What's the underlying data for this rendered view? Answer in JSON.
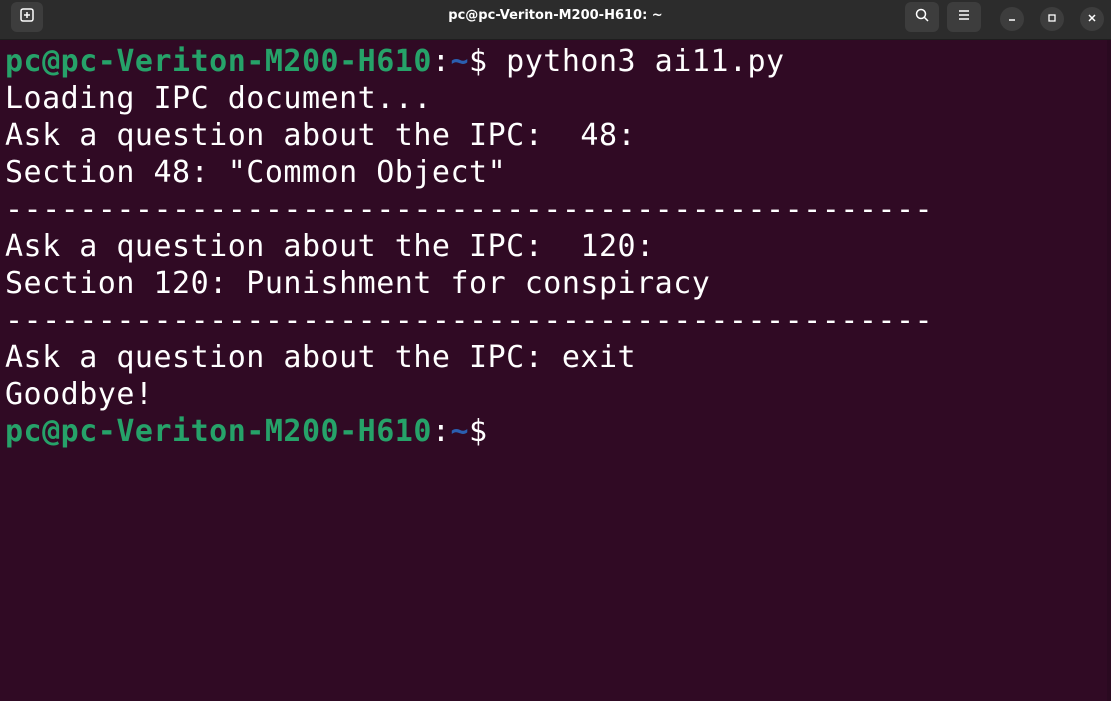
{
  "window": {
    "title": "pc@pc-Veriton-M200-H610: ~"
  },
  "titlebar_icons": {
    "new_tab": "new-tab-icon",
    "search": "search-icon",
    "menu": "hamburger-menu-icon",
    "minimize": "minimize-icon",
    "maximize": "maximize-icon",
    "close": "close-icon"
  },
  "colors": {
    "background": "#300a24",
    "prompt_user": "#26a269",
    "prompt_path": "#2a5fb0",
    "text": "#ffffff"
  },
  "terminal": {
    "prompt_user_host": "pc@pc-Veriton-M200-H610",
    "prompt_colon": ":",
    "prompt_path": "~",
    "prompt_dollar": "$",
    "command": " python3 ai11.py",
    "lines": [
      "Loading IPC document...",
      "Ask a question about the IPC:  48:",
      "Section 48: \"Common Object\"",
      "--------------------------------------------------",
      "Ask a question about the IPC:  120:",
      "Section 120: Punishment for conspiracy",
      "--------------------------------------------------",
      "Ask a question about the IPC: exit",
      "Goodbye!"
    ],
    "final_prompt_user_host": "pc@pc-Veriton-M200-H610",
    "final_prompt_colon": ":",
    "final_prompt_path": "~",
    "final_prompt_dollar": "$"
  }
}
